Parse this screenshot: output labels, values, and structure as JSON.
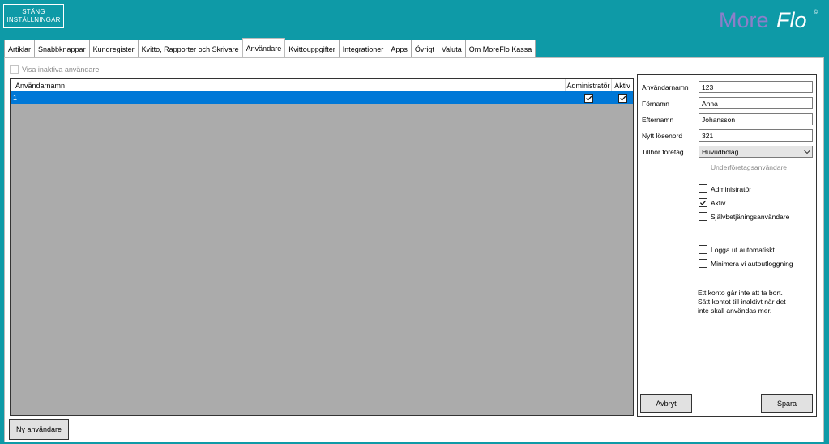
{
  "header": {
    "close_line1": "STÄNG",
    "close_line2": "INSTÄLLNINGAR",
    "logo_part1": "More",
    "logo_part2": "Flo",
    "logo_mark": "©"
  },
  "tabs": [
    {
      "label": "Artiklar"
    },
    {
      "label": "Snabbknappar"
    },
    {
      "label": "Kundregister"
    },
    {
      "label": "Kvitto, Rapporter och Skrivare"
    },
    {
      "label": "Användare"
    },
    {
      "label": "Kvittouppgifter"
    },
    {
      "label": "Integrationer"
    },
    {
      "label": "Apps"
    },
    {
      "label": "Övrigt"
    },
    {
      "label": "Valuta"
    },
    {
      "label": "Om MoreFlo Kassa"
    }
  ],
  "active_tab": "Användare",
  "show_inactive": {
    "label": "Visa inaktiva användare",
    "checked": false
  },
  "grid": {
    "columns": {
      "username": "Användarnamn",
      "admin": "Administratör",
      "active": "Aktiv"
    },
    "rows": [
      {
        "username": "1",
        "admin": true,
        "active": true
      }
    ]
  },
  "new_user_label": "Ny användare",
  "form": {
    "username_label": "Användarnamn",
    "username_value": "123",
    "firstname_label": "Förnamn",
    "firstname_value": "Anna",
    "lastname_label": "Efternamn",
    "lastname_value": "Johansson",
    "password_label": "Nytt lösenord",
    "password_value": "321",
    "company_label": "Tillhör företag",
    "company_value": "Huvudbolag",
    "subcompany_label": "Underföretagsanvändare",
    "admin_label": "Administratör",
    "admin_checked": false,
    "active_label": "Aktiv",
    "active_checked": true,
    "selfservice_label": "Självbetjäningsanvändare",
    "selfservice_checked": false,
    "autologout_label": "Logga ut automatiskt",
    "autologout_checked": false,
    "minimize_label": "Minimera vi autoutloggning",
    "minimize_checked": false,
    "note_line1": "Ett konto går inte att ta bort.",
    "note_line2": "Sätt kontot till inaktivt när det",
    "note_line3": "inte skall användas mer.",
    "cancel_label": "Avbryt",
    "save_label": "Spara"
  },
  "colors": {
    "background": "#0e9aa7",
    "logo": "#8b7fc9",
    "selection": "#0078d7",
    "grid_empty": "#ababab"
  }
}
